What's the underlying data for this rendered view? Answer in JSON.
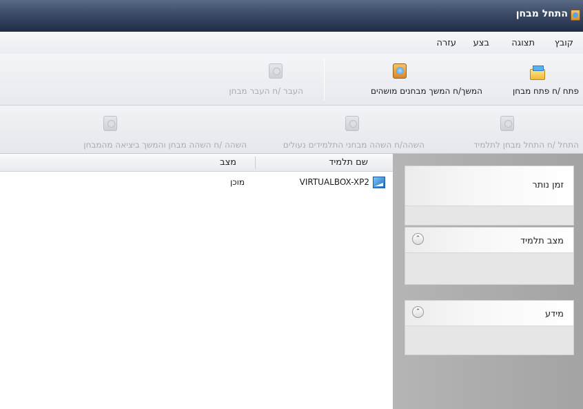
{
  "window": {
    "title": "התחל מבחן",
    "app_icon": "app-icon"
  },
  "menu": {
    "items": [
      "קובץ",
      "תצוגה",
      "בצע",
      "עזרה"
    ]
  },
  "toolbar1": {
    "open_test": "פתח /ח פתח מבחן",
    "continue_tests": "המשך/ח המשך מבחנים מושהים",
    "transfer_test": "העבר /ח העבר מבחן"
  },
  "toolbar2": {
    "start_test_student": "התחל /ח התחל מבחן לתלמיד",
    "pause_student_tests": "השהה/ח השהה מבחני התלמידים נעולים",
    "pause_continue_exit": "השהה /ח השהה מבחן והמשך ביציאה מהמבחן"
  },
  "grid": {
    "columns": [
      "שם תלמיד",
      "מצב"
    ],
    "rows": [
      {
        "student": "VIRTUALBOX-XP2",
        "status": "מוכן",
        "icon": "computer-icon"
      }
    ]
  },
  "sidebar": {
    "panels": [
      {
        "title": "זמן נותר",
        "collapsible": false
      },
      {
        "title": "מצב תלמיד",
        "collapsible": true
      },
      {
        "title": "מידע",
        "collapsible": true
      }
    ]
  },
  "colors": {
    "titlebar": "#2b3a56",
    "sidebar": "#acacac",
    "panel": "#ececec"
  }
}
